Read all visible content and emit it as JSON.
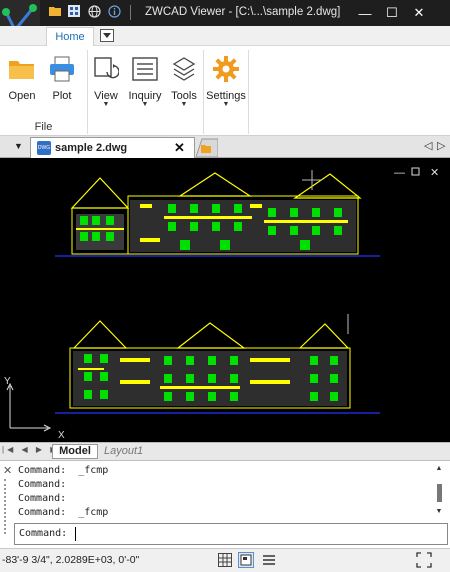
{
  "app": {
    "title": "ZWCAD Viewer - [C:\\...\\sample 2.dwg]"
  },
  "quick_access": {
    "icons": [
      "folder-icon",
      "grid-icon",
      "globe-icon",
      "info-icon"
    ]
  },
  "window_controls": {
    "minimize": "—",
    "maximize": "☐",
    "close": "✕"
  },
  "ribbon": {
    "tab_home": "Home",
    "buttons": {
      "open": "Open",
      "plot": "Plot",
      "view": "View",
      "inquiry": "Inquiry",
      "tools": "Tools",
      "settings": "Settings"
    },
    "group_file": "File"
  },
  "document": {
    "tab_label": "sample 2.dwg",
    "close_glyph": "✕"
  },
  "layout_tabs": {
    "model": "Model",
    "layout1": "Layout1"
  },
  "command": {
    "history": [
      "Command:  _fcmp",
      "Command:",
      "Command:",
      "Command:  _fcmp"
    ],
    "prompt": "Command:"
  },
  "status": {
    "coordinates": "-83'-9 3/4\", 2.0289E+03, 0'-0\""
  },
  "viewport": {
    "axis_x": "X",
    "axis_y": "Y"
  },
  "colors": {
    "accent": "#1f6fb2",
    "drawing_yellow": "#ffff00",
    "drawing_green": "#00e000",
    "drawing_blue": "#2233ff"
  }
}
